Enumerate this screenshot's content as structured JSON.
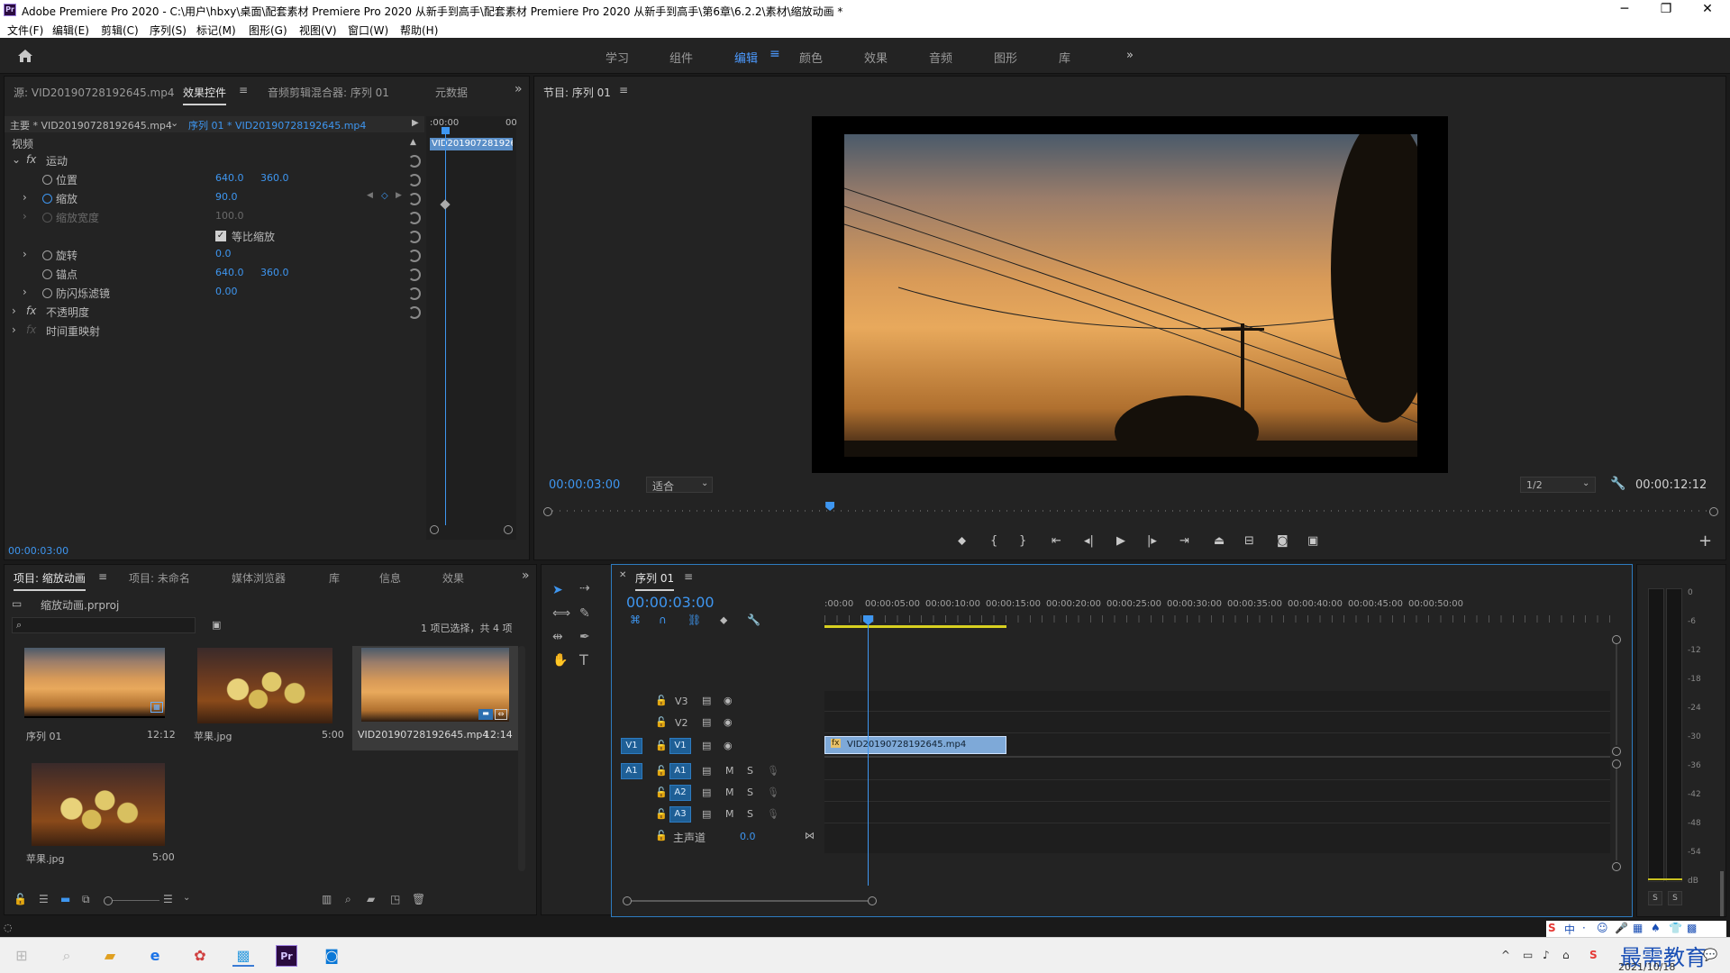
{
  "window": {
    "title": "Adobe Premiere Pro 2020 - C:\\用户\\hbxy\\桌面\\配套素材 Premiere Pro 2020 从新手到高手\\配套素材 Premiere Pro 2020 从新手到高手\\第6章\\6.2.2\\素材\\缩放动画 *",
    "logo_text": "Pr",
    "minimize": "─",
    "maximize": "❐",
    "close": "✕"
  },
  "menu": [
    "文件(F)",
    "编辑(E)",
    "剪辑(C)",
    "序列(S)",
    "标记(M)",
    "图形(G)",
    "视图(V)",
    "窗口(W)",
    "帮助(H)"
  ],
  "workspaces": {
    "tabs": [
      "学习",
      "组件",
      "编辑",
      "颜色",
      "效果",
      "音频",
      "图形",
      "库"
    ],
    "active": "编辑",
    "overflow": "»"
  },
  "effect_panel": {
    "tabs": [
      "源: VID20190728192645.mp4",
      "效果控件",
      "音频剪辑混合器: 序列 01",
      "元数据"
    ],
    "active_tab": "效果控件",
    "master_clip": "主要 * VID20190728192645.mp4",
    "sequence_clip": "序列 01 * VID20190728192645.mp4",
    "ruler_start": ":00:00",
    "ruler_end": "00",
    "clip_label": "VID201907281926",
    "section": "视频",
    "motion": "运动",
    "props": [
      {
        "name": "位置",
        "v1": "640.0",
        "v2": "360.0"
      },
      {
        "name": "缩放",
        "v1": "90.0",
        "v2": ""
      },
      {
        "name": "缩放宽度",
        "v1": "100.0",
        "v2": ""
      },
      {
        "name": "等比缩放",
        "v1": "",
        "v2": ""
      },
      {
        "name": "旋转",
        "v1": "0.0",
        "v2": ""
      },
      {
        "name": "锚点",
        "v1": "640.0",
        "v2": "360.0"
      },
      {
        "name": "防闪烁滤镜",
        "v1": "0.00",
        "v2": ""
      }
    ],
    "opacity": "不透明度",
    "time_remap": "时间重映射",
    "timecode": "00:00:03:00"
  },
  "program": {
    "title": "节目: 序列 01",
    "timecode": "00:00:03:00",
    "fit": "适合",
    "quality": "1/2",
    "duration": "00:00:12:12",
    "playhead_fraction": 0.24
  },
  "project": {
    "tabs": [
      "项目: 缩放动画",
      "项目: 未命名",
      "媒体浏览器",
      "库",
      "信息",
      "效果"
    ],
    "active_tab": "项目: 缩放动画",
    "file": "缩放动画.prproj",
    "selection": "1 项已选择，共 4 项",
    "items": [
      {
        "name": "序列 01",
        "dur": "12:12",
        "kind": "sunset"
      },
      {
        "name": "苹果.jpg",
        "dur": "5:00",
        "kind": "apple"
      },
      {
        "name": "VID20190728192645.mp4",
        "dur": "12:14",
        "kind": "sunset"
      },
      {
        "name": "苹果.jpg",
        "dur": "5:00",
        "kind": "apple"
      }
    ]
  },
  "timeline": {
    "title": "序列 01",
    "timecode": "00:00:03:00",
    "ruler": [
      ":00:00",
      "00:00:05:00",
      "00:00:10:00",
      "00:00:15:00",
      "00:00:20:00",
      "00:00:25:00",
      "00:00:30:00",
      "00:00:35:00",
      "00:00:40:00",
      "00:00:45:00",
      "00:00:50:00"
    ],
    "video_tracks": [
      "V3",
      "V2",
      "V1"
    ],
    "audio_tracks": [
      "A1",
      "A2",
      "A3"
    ],
    "master": "主声道",
    "master_val": "0.0",
    "clip": "VID20190728192645.mp4",
    "src_v": "V1",
    "src_a": "A1"
  },
  "meter": {
    "scale": [
      "0",
      "-6",
      "-12",
      "-18",
      "-24",
      "-30",
      "-36",
      "-42",
      "-48",
      "-54",
      "dB"
    ],
    "solo": [
      "S",
      "S"
    ]
  },
  "tray": {
    "ime": "中",
    "date": "2021/10/18",
    "watermark": "最需教育"
  }
}
